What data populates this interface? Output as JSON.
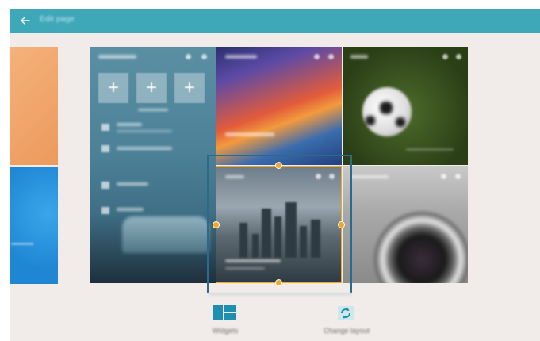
{
  "topbar": {
    "title": "Edit page",
    "color": "#3ea8b9"
  },
  "panels": {
    "settings": {
      "title": "Quick Settings",
      "rows": [
        "Display",
        "Connections",
        "Wallpaper",
        "Sound"
      ]
    },
    "art": {
      "title": "Art"
    },
    "soccer": {
      "title": "Sport"
    },
    "city": {
      "title": "News"
    },
    "camera": {
      "title": "Photo"
    }
  },
  "bottom": {
    "widgets_label": "Widgets",
    "change_layout_label": "Change layout"
  },
  "colors": {
    "accent": "#3ea8b9",
    "selection_handle": "#f5a623",
    "selection_frame": "#2a6b8a"
  },
  "icons": {
    "back": "arrow-left-icon",
    "widgets": "grid-layout-icon",
    "change_layout": "refresh-icon"
  }
}
